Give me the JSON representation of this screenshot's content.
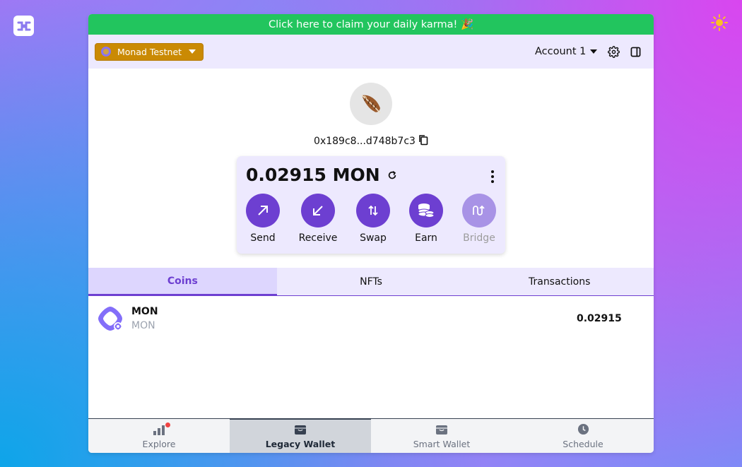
{
  "app": {
    "logo_icon": "app-logo-icon",
    "theme_icon": "sun-icon"
  },
  "banner": {
    "text": "Click here to claim your daily karma! 🎉",
    "color": "#22c55e"
  },
  "header": {
    "network_label": "Monad Testnet",
    "network_color": "#ca8a04",
    "account_label": "Account 1",
    "icons": [
      "gear-icon",
      "sidebar-panel-icon"
    ]
  },
  "wallet": {
    "avatar_icon": "feather-icon",
    "address": "0x189c8...d748b7c3",
    "balance": "0.02915 MON",
    "actions": [
      {
        "label": "Send",
        "icon": "arrow-up-right-icon",
        "enabled": true
      },
      {
        "label": "Receive",
        "icon": "arrow-down-left-icon",
        "enabled": true
      },
      {
        "label": "Swap",
        "icon": "swap-arrows-icon",
        "enabled": true
      },
      {
        "label": "Earn",
        "icon": "coins-stack-icon",
        "enabled": true
      },
      {
        "label": "Bridge",
        "icon": "bridge-icon",
        "enabled": false
      }
    ],
    "accent_color": "#6d3fd1"
  },
  "tabs": [
    {
      "label": "Coins",
      "active": true
    },
    {
      "label": "NFTs",
      "active": false
    },
    {
      "label": "Transactions",
      "active": false
    }
  ],
  "coins": [
    {
      "name": "MON",
      "symbol": "MON",
      "amount": "0.02915"
    }
  ],
  "bottom_nav": [
    {
      "label": "Explore",
      "icon": "bar-chart-icon",
      "active": false,
      "has_badge": true
    },
    {
      "label": "Legacy Wallet",
      "icon": "wallet-icon",
      "active": true
    },
    {
      "label": "Smart Wallet",
      "icon": "smart-wallet-icon",
      "active": false
    },
    {
      "label": "Schedule",
      "icon": "clock-icon",
      "active": false
    }
  ]
}
